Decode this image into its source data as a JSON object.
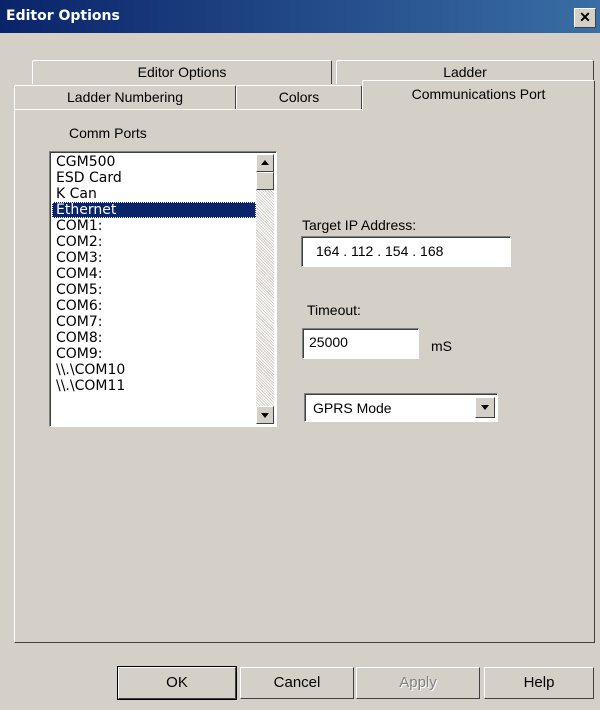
{
  "window": {
    "title": "Editor Options",
    "close_label": "✕"
  },
  "tabs_row1": [
    {
      "label": "Editor Options"
    },
    {
      "label": "Ladder"
    }
  ],
  "tabs_row2": [
    {
      "label": "Ladder Numbering"
    },
    {
      "label": "Colors"
    },
    {
      "label": "Communications Port",
      "active": true
    }
  ],
  "comm": {
    "label": "Comm Ports",
    "items": [
      "CGM500",
      "ESD Card",
      "K Can",
      "Ethernet",
      "COM1:",
      "COM2:",
      "COM3:",
      "COM4:",
      "COM5:",
      "COM6:",
      "COM7:",
      "COM8:",
      "COM9:",
      "\\\\.\\COM10",
      "\\\\.\\COM11"
    ],
    "selected": "Ethernet"
  },
  "ip": {
    "label": "Target IP Address:",
    "value": "164 . 112 . 154 . 168"
  },
  "timeout": {
    "label": "Timeout:",
    "value": "25000",
    "unit": "mS"
  },
  "mode": {
    "selected": "GPRS Mode"
  },
  "buttons": {
    "ok": "OK",
    "cancel": "Cancel",
    "apply": "Apply",
    "help": "Help"
  }
}
